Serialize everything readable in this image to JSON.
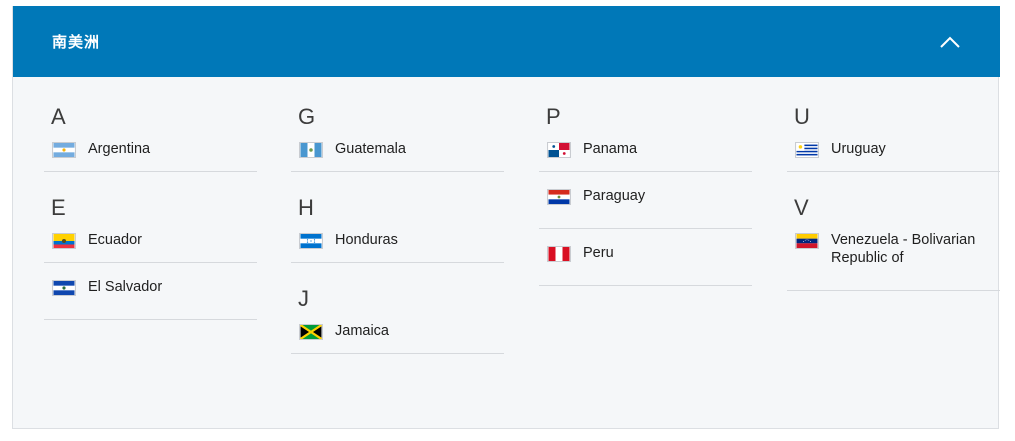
{
  "region": {
    "title": "南美洲",
    "collapse_icon": "chevron-up-icon"
  },
  "columns": [
    {
      "groups": [
        {
          "letter": "A",
          "countries": [
            {
              "name": "Argentina",
              "flag": "argentina-flag-icon"
            }
          ]
        },
        {
          "letter": "E",
          "countries": [
            {
              "name": "Ecuador",
              "flag": "ecuador-flag-icon"
            },
            {
              "name": "El Salvador",
              "flag": "el-salvador-flag-icon"
            }
          ]
        }
      ]
    },
    {
      "groups": [
        {
          "letter": "G",
          "countries": [
            {
              "name": "Guatemala",
              "flag": "guatemala-flag-icon"
            }
          ]
        },
        {
          "letter": "H",
          "countries": [
            {
              "name": "Honduras",
              "flag": "honduras-flag-icon"
            }
          ]
        },
        {
          "letter": "J",
          "countries": [
            {
              "name": "Jamaica",
              "flag": "jamaica-flag-icon"
            }
          ]
        }
      ]
    },
    {
      "groups": [
        {
          "letter": "P",
          "countries": [
            {
              "name": "Panama",
              "flag": "panama-flag-icon"
            },
            {
              "name": "Paraguay",
              "flag": "paraguay-flag-icon"
            },
            {
              "name": "Peru",
              "flag": "peru-flag-icon"
            }
          ]
        }
      ]
    },
    {
      "groups": [
        {
          "letter": "U",
          "countries": [
            {
              "name": "Uruguay",
              "flag": "uruguay-flag-icon"
            }
          ]
        },
        {
          "letter": "V",
          "countries": [
            {
              "name": "Venezuela - Bolivarian Republic of",
              "flag": "venezuela-flag-icon"
            }
          ]
        }
      ]
    }
  ],
  "colors": {
    "header_bg": "#0078b8",
    "panel_bg": "#f5f7f9"
  }
}
